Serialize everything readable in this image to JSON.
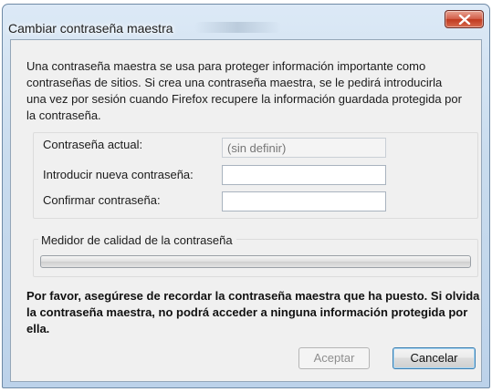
{
  "window": {
    "title": "Cambiar contraseña maestra"
  },
  "intro_text": "Una contraseña maestra se usa para proteger información importante como contraseñas de sitios. Si crea una contraseña maestra, se le pedirá introducirla una vez por sesión cuando Firefox recupere la información guardada protegida por la contraseña.",
  "form": {
    "current_label": "Contraseña actual:",
    "current_placeholder": "(sin definir)",
    "new_label": "Introducir nueva contraseña:",
    "new_value": "",
    "confirm_label": "Confirmar contraseña:",
    "confirm_value": ""
  },
  "quality": {
    "label": "Medidor de calidad de la contraseña",
    "fraction": 0
  },
  "warning_text": "Por favor, asegúrese de recordar la contraseña maestra que ha puesto. Si olvida la contraseña maestra, no podrá acceder a ninguna información protegida por ella.",
  "buttons": {
    "accept_label": "Aceptar",
    "cancel_label": "Cancelar"
  },
  "colors": {
    "close_button": "#c9452b",
    "titlebar": "#c9dcee",
    "dialog_background": "#f0f0f0",
    "default_button_border": "#3c7fb1"
  },
  "icons": {
    "close": "close-icon"
  }
}
